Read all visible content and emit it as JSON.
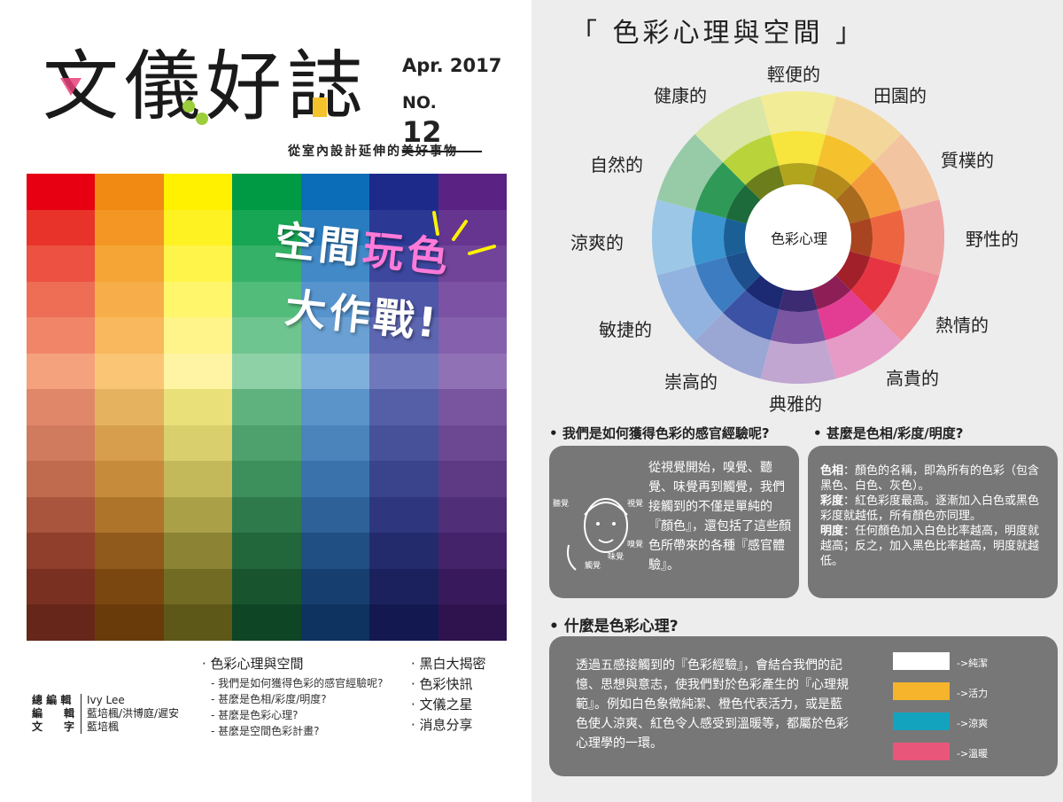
{
  "magazine": {
    "masthead": "文儀好誌",
    "date": "Apr. 2017",
    "no_prefix": "NO.",
    "no_value": "12",
    "tagline": "從室內設計延伸的美好事物",
    "cover_title_line1": "空間",
    "cover_title_line1b": "玩色",
    "cover_title_line2": "大作戰!"
  },
  "palette": {
    "columns": [
      [
        "#e60012",
        "#e8332a",
        "#ec5142",
        "#ee6d55",
        "#f08567",
        "#f4a27d",
        "#e0876a",
        "#d07a5e",
        "#c06a4e",
        "#a9543d",
        "#8f3f2c",
        "#7a3020",
        "#66261a"
      ],
      [
        "#f08a13",
        "#f39624",
        "#f5a536",
        "#f7ae4a",
        "#f9b85d",
        "#fac676",
        "#e5b25f",
        "#d79e4d",
        "#c78b3c",
        "#ae7429",
        "#8f5a1b",
        "#7a4710",
        "#6a3b0a"
      ],
      [
        "#fff100",
        "#fff222",
        "#fff44a",
        "#fff66c",
        "#fff489",
        "#fff4a3",
        "#e9e07a",
        "#d9cf6d",
        "#c4b95a",
        "#aaa047",
        "#8c8434",
        "#726b24",
        "#5e5818"
      ],
      [
        "#009a44",
        "#17a653",
        "#35b267",
        "#52bc7b",
        "#6fc58f",
        "#8ed1a7",
        "#5fb27e",
        "#4ea06c",
        "#3d8f5c",
        "#2f7a4b",
        "#22663b",
        "#18552f",
        "#0e4524"
      ],
      [
        "#0b6cb7",
        "#2a7cc0",
        "#4289c8",
        "#5794ce",
        "#6aa0d4",
        "#7fb0dc",
        "#5a94c8",
        "#4a84ba",
        "#3a72ac",
        "#2d6198",
        "#204f83",
        "#163f70",
        "#0e3360"
      ],
      [
        "#1d2a8a",
        "#2b3894",
        "#3d479e",
        "#4e57a8",
        "#5d66b0",
        "#6f78ba",
        "#545fa7",
        "#47519a",
        "#3a448c",
        "#2e377d",
        "#242b6d",
        "#1b215d",
        "#141851"
      ],
      [
        "#5a2383",
        "#663590",
        "#71449a",
        "#7c52a4",
        "#8560ac",
        "#9171b6",
        "#7a559f",
        "#6c4792",
        "#5e3a85",
        "#512e78",
        "#44236a",
        "#381a5c",
        "#2e134f"
      ]
    ]
  },
  "toc": {
    "left_header": "色彩心理與空間",
    "left_items": [
      "我們是如何獲得色彩的感官經驗呢?",
      "甚麼是色相/彩度/明度?",
      "甚麼是色彩心理?",
      "甚麼是空間色彩計畫?"
    ],
    "right_items": [
      "黑白大揭密",
      "色彩快訊",
      "文儀之星",
      "消息分享"
    ]
  },
  "credits": {
    "labels": [
      "總 編 輯",
      "編　　輯",
      "文　　字"
    ],
    "values": [
      "Ivy Lee",
      "藍培楓/洪博庭/遲安",
      "藍培楓"
    ]
  },
  "wheel": {
    "title": "「 色彩心理與空間 」",
    "center": "色彩心理",
    "labels": [
      "輕便的",
      "田園的",
      "質樸的",
      "野性的",
      "熱情的",
      "高貴的",
      "典雅的",
      "崇高的",
      "敏捷的",
      "涼爽的",
      "自然的",
      "健康的"
    ],
    "outer_colors": [
      "#f2ec96",
      "#f3d79a",
      "#f2c49f",
      "#eea3a3",
      "#ee8f9a",
      "#e59bc6",
      "#c1a6d1",
      "#9aa6d4",
      "#92b3e0",
      "#9cc7e6",
      "#97cba8",
      "#d9e6a5"
    ],
    "mid_colors": [
      "#f7e43d",
      "#f5c12d",
      "#f39a3a",
      "#ec6540",
      "#e73442",
      "#e23d92",
      "#7a55a2",
      "#3c52a5",
      "#3e7cc1",
      "#3a95d0",
      "#2f9a58",
      "#b8d43a"
    ],
    "inner_colors": [
      "#b2a51e",
      "#b38b1b",
      "#a86a1c",
      "#a84520",
      "#a1202a",
      "#8d1f56",
      "#3c2a72",
      "#1b2a72",
      "#1c4f8c",
      "#1a6097",
      "#1d6a3a",
      "#6c7e1c"
    ]
  },
  "sections": {
    "q1": "我們是如何獲得色彩的感官經驗呢?",
    "q2": "甚麼是色相/彩度/明度?",
    "q3": "什麼是色彩心理?",
    "box1_text": "從視覺開始，嗅覺、聽覺、味覺再到觸覺，我們接觸到的不僅是單純的『顏色』，還包括了這些顏色所帶來的各種『感官體驗』。",
    "senses": [
      "聽覺",
      "視覺",
      "嗅覺",
      "味覺",
      "觸覺"
    ],
    "box2": [
      {
        "term": "色相",
        "text": "：顏色的名稱，即為所有的色彩（包含黑色、白色、灰色）。"
      },
      {
        "term": "彩度",
        "text": "：紅色彩度最高。逐漸加入白色或黑色彩度就越低，所有顏色亦同理。"
      },
      {
        "term": "明度",
        "text": "：任何顏色加入白色比率越高，明度就越高；反之，加入黑色比率越高，明度就越低。"
      }
    ],
    "box3_text": "透過五感接觸到的『色彩經驗』，會結合我們的記憶、思想與意志，使我們對於色彩產生的『心理規範』。例如白色象徵純潔、橙色代表活力，或是藍色使人涼爽、紅色令人感受到溫暖等，都屬於色彩心理學的一環。",
    "swatches": [
      {
        "color": "#ffffff",
        "label": "->純潔"
      },
      {
        "color": "#f5b42c",
        "label": "->活力"
      },
      {
        "color": "#14a3be",
        "label": "->涼爽"
      },
      {
        "color": "#e8577a",
        "label": "->溫暖"
      }
    ]
  }
}
